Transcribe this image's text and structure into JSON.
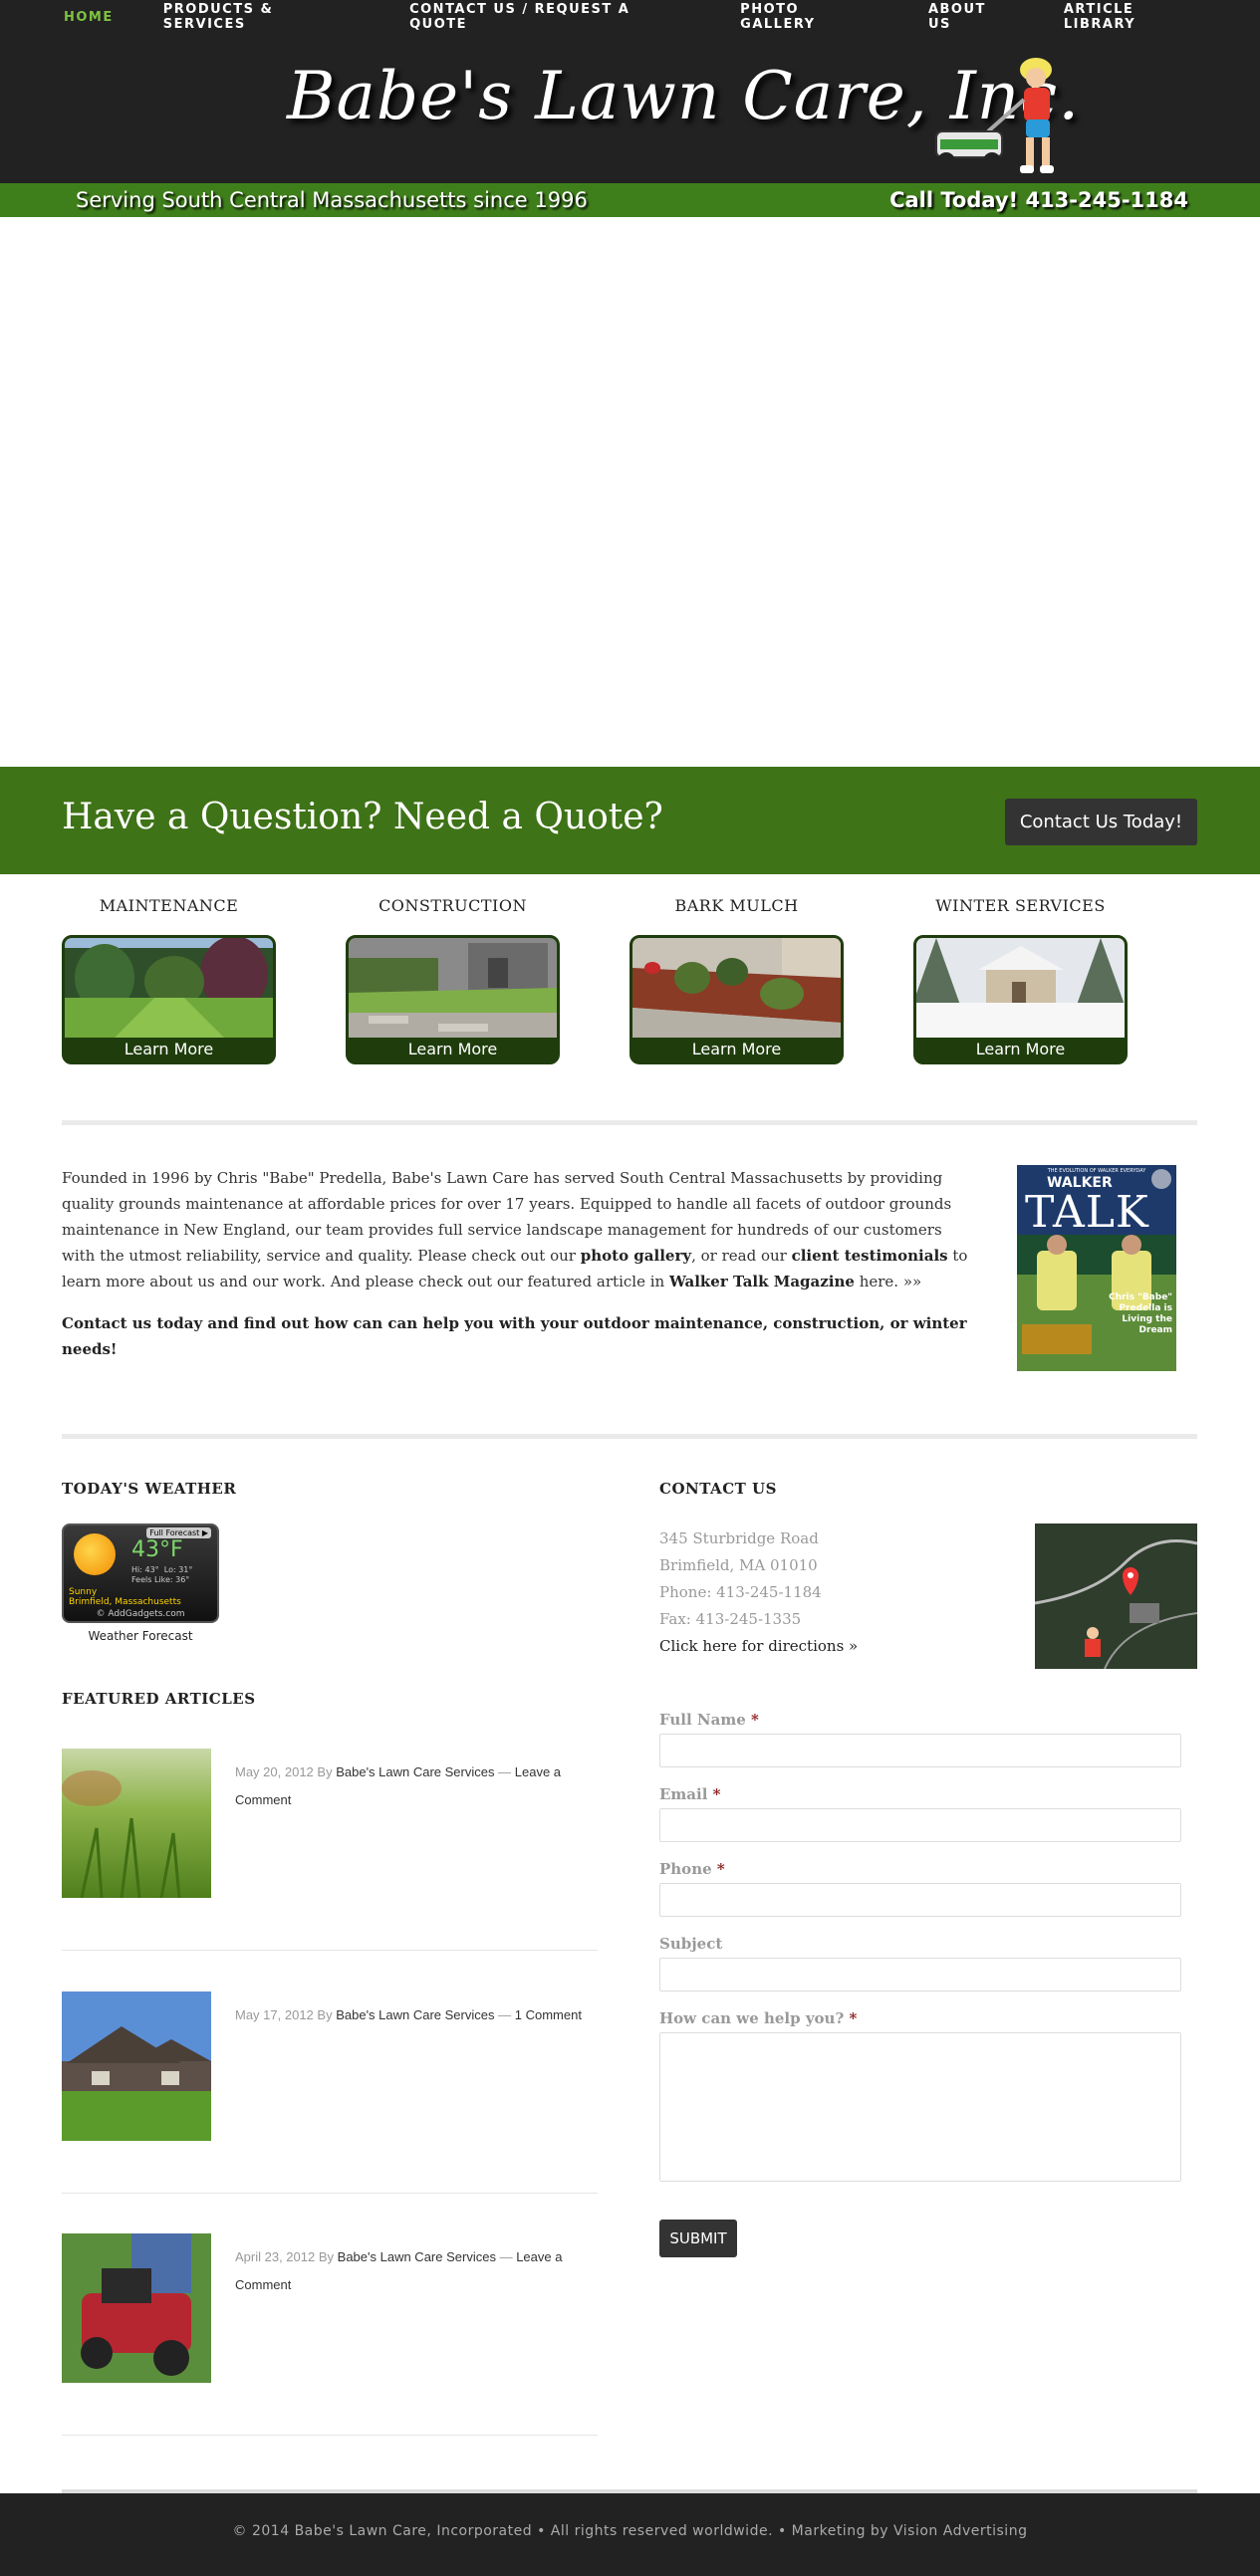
{
  "nav": {
    "items": [
      {
        "label": "HOME",
        "active": true
      },
      {
        "label": "PRODUCTS & SERVICES",
        "active": false
      },
      {
        "label": "CONTACT US / REQUEST A QUOTE",
        "active": false
      },
      {
        "label": "PHOTO GALLERY",
        "active": false
      },
      {
        "label": "ABOUT US",
        "active": false
      },
      {
        "label": "ARTICLE LIBRARY",
        "active": false
      }
    ]
  },
  "header": {
    "logo_text": "Babe's Lawn Care, Inc.",
    "tagline": "Serving South Central Massachusetts since 1996",
    "phone_cta": "Call Today! 413-245-1184"
  },
  "cta": {
    "heading": "Have a Question? Need a Quote?",
    "button": "Contact Us Today!"
  },
  "services": [
    {
      "title": "MAINTENANCE",
      "button": "Learn More"
    },
    {
      "title": "CONSTRUCTION",
      "button": "Learn More"
    },
    {
      "title": "BARK MULCH",
      "button": "Learn More"
    },
    {
      "title": "WINTER SERVICES",
      "button": "Learn More"
    }
  ],
  "about": {
    "p1_a": "Founded in 1996 by Chris \"Babe\" Predella, Babe's Lawn Care has served South Central Massachusetts by providing quality grounds maintenance at affordable prices for over 17 years. Equipped to handle all facets of outdoor grounds maintenance in New England, our team provides full service landscape management for hundreds of our customers with the utmost reliability, service and quality.  Please check out our ",
    "link_gallery": "photo gallery",
    "p1_b": ", or read our ",
    "link_testimonials": "client testimonials",
    "p1_c": " to learn more about us and our work. And please check out our featured article in ",
    "link_magazine": "Walker Talk Magazine",
    "p1_d": " here. »»",
    "p2": "Contact us today and find out how can can help you with your outdoor maintenance, construction, or winter needs!",
    "magazine": {
      "top": "THE EVOLUTION OF WALKER EVERYDAY",
      "brand": "WALKER",
      "name": "TALK",
      "caption": "Chris \"Babe\" Predella is Living the Dream"
    }
  },
  "weather": {
    "title": "TODAY'S WEATHER",
    "full_forecast": "Full Forecast ▶",
    "temp": "43°F",
    "hi": "Hi: 43°",
    "lo": "Lo: 31°",
    "feels": "Feels Like: 36°",
    "condition": "Sunny",
    "location": "Brimfield, Massachusetts",
    "credit": "© AddGadgets.com",
    "caption": "Weather Forecast"
  },
  "articles": {
    "title": "FEATURED ARTICLES",
    "items": [
      {
        "date": "May 20, 2012",
        "by": "By",
        "author": "Babe's Lawn Care Services",
        "sep": "—",
        "comments": "Leave a Comment"
      },
      {
        "date": "May 17, 2012",
        "by": "By",
        "author": "Babe's Lawn Care Services",
        "sep": "—",
        "comments": "1 Comment"
      },
      {
        "date": "April 23, 2012",
        "by": "By",
        "author": "Babe's Lawn Care Services",
        "sep": "—",
        "comments": "Leave a Comment"
      }
    ]
  },
  "contact": {
    "title": "CONTACT US",
    "street": "345 Sturbridge Road",
    "city": "Brimfield, MA 01010",
    "phone": "Phone: 413-245-1184",
    "fax": "Fax: 413-245-1335",
    "directions": "Click here for directions »",
    "form": {
      "name_label": "Full Name",
      "email_label": "Email",
      "phone_label": "Phone",
      "subject_label": "Subject",
      "message_label": "How can we help you?",
      "required_mark": "*",
      "submit": "SUBMIT"
    }
  },
  "footer": {
    "text": "© 2014 Babe's Lawn Care, Incorporated • All rights reserved worldwide. • Marketing by Vision Advertising"
  },
  "colors": {
    "nav_active": "#7ec242",
    "brand_green": "#3f7f1b",
    "cta_green": "#3f7317",
    "dark": "#222222"
  }
}
